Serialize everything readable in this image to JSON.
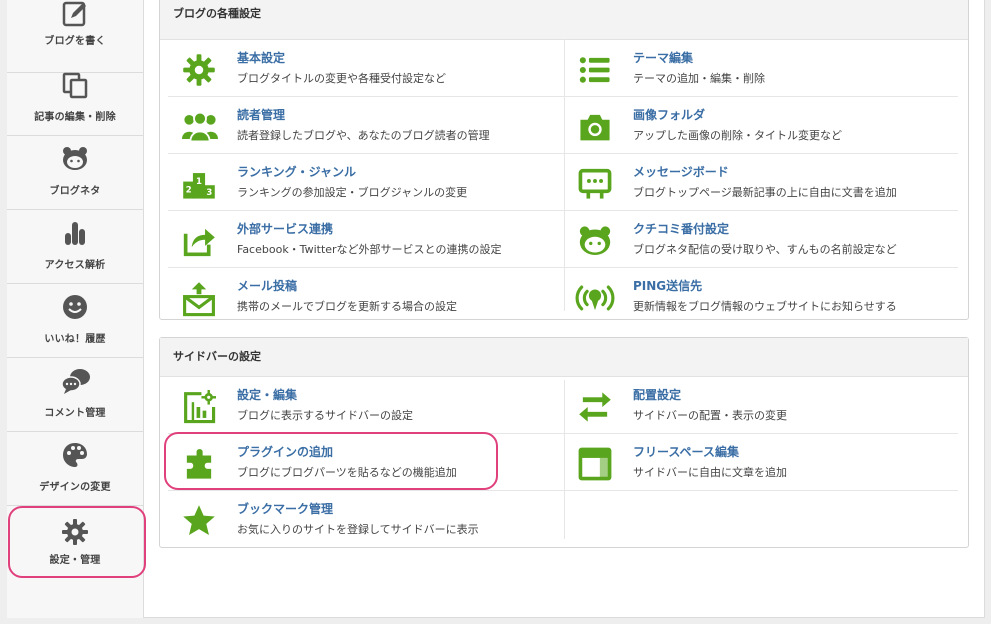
{
  "nav": [
    {
      "label": "ブログを書く",
      "icon": "edit-icon"
    },
    {
      "label": "記事の編集・削除",
      "icon": "documents-icon"
    },
    {
      "label": "ブログネタ",
      "icon": "mascot-icon"
    },
    {
      "label": "アクセス解析",
      "icon": "bar-chart-icon"
    },
    {
      "label": "いいね！履歴",
      "icon": "smiley-icon"
    },
    {
      "label": "コメント管理",
      "icon": "chat-bubbles-icon"
    },
    {
      "label": "デザインの変更",
      "icon": "palette-icon"
    },
    {
      "label": "設定・管理",
      "icon": "gear-icon"
    }
  ],
  "blog_settings": {
    "header": "ブログの各種設定",
    "items": [
      {
        "title": "基本設定",
        "desc": "ブログタイトルの変更や各種受付設定など",
        "icon": "gear-icon"
      },
      {
        "title": "テーマ編集",
        "desc": "テーマの追加・編集・削除",
        "icon": "list-icon"
      },
      {
        "title": "読者管理",
        "desc": "読者登録したブログや、あなたのブログ読者の管理",
        "icon": "readers-icon"
      },
      {
        "title": "画像フォルダ",
        "desc": "アップした画像の削除・タイトル変更など",
        "icon": "camera-icon"
      },
      {
        "title": "ランキング・ジャンル",
        "desc": "ランキングの参加設定・ブログジャンルの変更",
        "icon": "podium-icon"
      },
      {
        "title": "メッセージボード",
        "desc": "ブログトップページ最新記事の上に自由に文書を追加",
        "icon": "message-board-icon"
      },
      {
        "title": "外部サービス連携",
        "desc": "Facebook・Twitterなど外部サービスとの連携の設定",
        "icon": "share-icon"
      },
      {
        "title": "クチコミ番付設定",
        "desc": "ブログネタ配信の受け取りや、すんもの名前設定など",
        "icon": "mascot-icon"
      },
      {
        "title": "メール投稿",
        "desc": "携帯のメールでブログを更新する場合の設定",
        "icon": "mail-upload-icon"
      },
      {
        "title": "PING送信先",
        "desc": "更新情報をブログ情報のウェブサイトにお知らせする",
        "icon": "broadcast-icon"
      }
    ]
  },
  "sidebar_settings": {
    "header": "サイドバーの設定",
    "items": [
      {
        "title": "設定・編集",
        "desc": "ブログに表示するサイドバーの設定",
        "icon": "sidebar-gear-icon"
      },
      {
        "title": "配置設定",
        "desc": "サイドバーの配置・表示の変更",
        "icon": "swap-arrows-icon"
      },
      {
        "title": "プラグインの追加",
        "desc": "ブログにブログパーツを貼るなどの機能追加",
        "icon": "puzzle-icon"
      },
      {
        "title": "フリースペース編集",
        "desc": "サイドバーに自由に文章を追加",
        "icon": "layout-icon"
      },
      {
        "title": "ブックマーク管理",
        "desc": "お気に入りのサイトを登録してサイドバーに表示",
        "icon": "star-icon"
      }
    ]
  },
  "colors": {
    "accent": "#5aa51e",
    "link": "#3a6ea5",
    "highlight": "#e0407c"
  }
}
